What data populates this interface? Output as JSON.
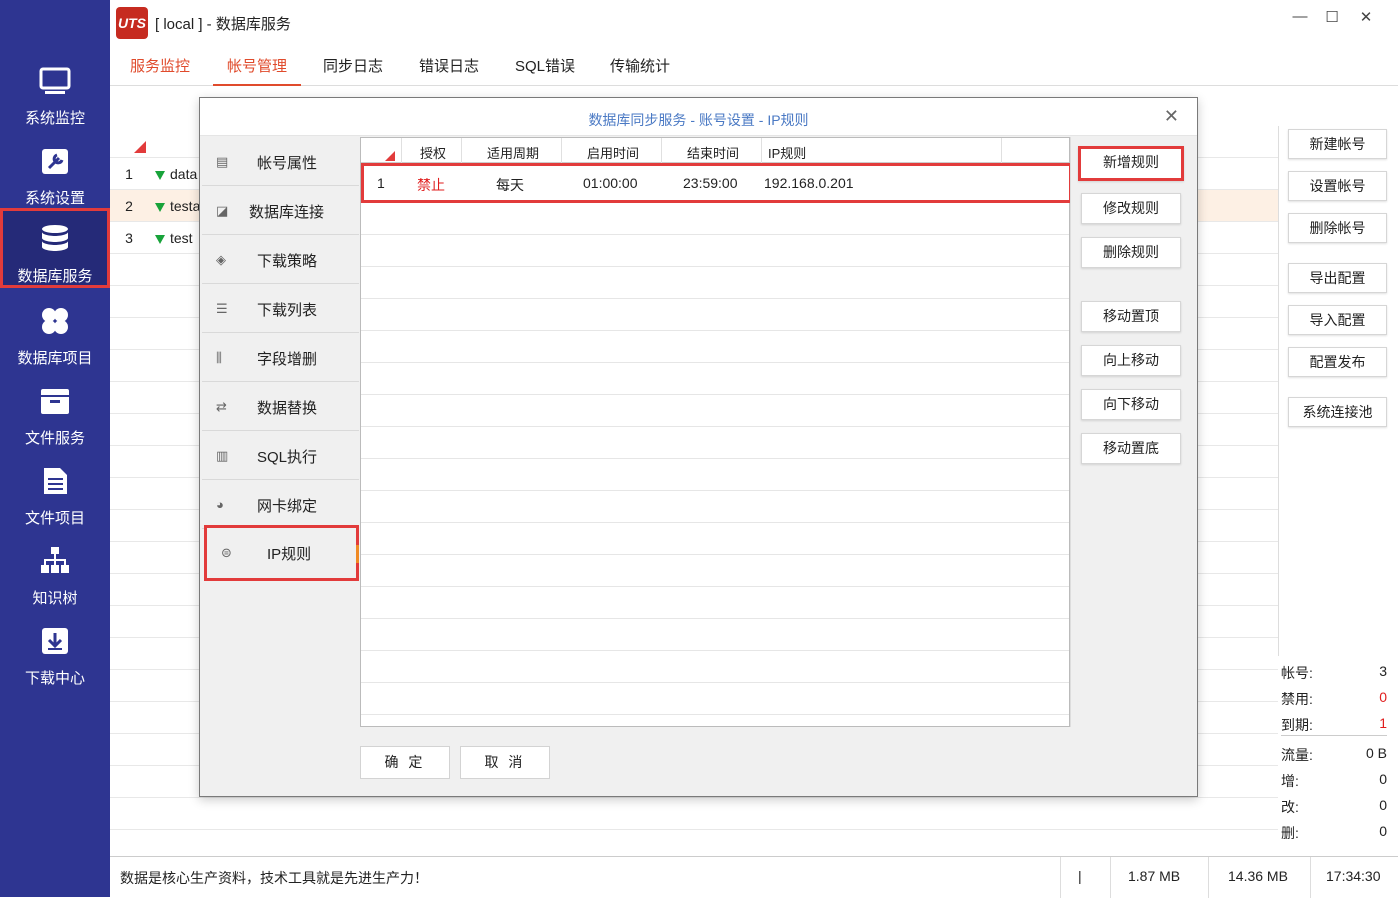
{
  "window": {
    "title": "[ local ] - 数据库服务",
    "logo_text": "UTS"
  },
  "nav": [
    {
      "label": "系统监控",
      "icon": "monitor-icon"
    },
    {
      "label": "系统设置",
      "icon": "settings-icon"
    },
    {
      "label": "数据库服务",
      "icon": "database-icon"
    },
    {
      "label": "数据库项目",
      "icon": "grid-icon"
    },
    {
      "label": "文件服务",
      "icon": "folder-icon"
    },
    {
      "label": "文件项目",
      "icon": "file-list-icon"
    },
    {
      "label": "知识树",
      "icon": "tree-icon"
    },
    {
      "label": "下载中心",
      "icon": "download-icon"
    }
  ],
  "tabs": [
    "服务监控",
    "帐号管理",
    "同步日志",
    "错误日志",
    "SQL错误",
    "传输统计"
  ],
  "bg_rows": [
    {
      "num": "1",
      "text": "data"
    },
    {
      "num": "2",
      "text": "testa"
    },
    {
      "num": "3",
      "text": "test"
    }
  ],
  "right_buttons": [
    "新建帐号",
    "设置帐号",
    "删除帐号",
    "导出配置",
    "导入配置",
    "配置发布",
    "系统连接池"
  ],
  "stats": [
    {
      "k": "帐号:",
      "v": "3"
    },
    {
      "k": "禁用:",
      "v": "0"
    },
    {
      "k": "到期:",
      "v": "1"
    },
    {
      "k": "流量:",
      "v": "0 B"
    },
    {
      "k": "增:",
      "v": "0"
    },
    {
      "k": "改:",
      "v": "0"
    },
    {
      "k": "删:",
      "v": "0"
    }
  ],
  "status": {
    "message": "数据是核心生产资料，技术工具就是先进生产力！",
    "sep": "|",
    "mem1": "1.87 MB",
    "mem2": "14.36 MB",
    "time": "17:34:30"
  },
  "dialog": {
    "title": "数据库同步服务 - 账号设置 - IP规则",
    "menu": [
      "帐号属性",
      "数据库连接",
      "下载策略",
      "下载列表",
      "字段增删",
      "数据替换",
      "SQL执行",
      "网卡绑定",
      "IP规则"
    ],
    "grid_headers": [
      "授权",
      "适用周期",
      "启用时间",
      "结束时间",
      "IP规则"
    ],
    "rows": [
      {
        "num": "1",
        "auth": "禁止",
        "period": "每天",
        "start": "01:00:00",
        "end": "23:59:00",
        "ip": "192.168.0.201"
      }
    ],
    "buttons": [
      "新增规则",
      "修改规则",
      "删除规则",
      "移动置顶",
      "向上移动",
      "向下移动",
      "移动置底"
    ],
    "ok": "确 定",
    "cancel": "取 消"
  },
  "colors": {
    "nav_bg": "#2e3591",
    "accent": "#e04b2c",
    "highlight": "#e23b3b",
    "deny": "#e01e1e"
  }
}
